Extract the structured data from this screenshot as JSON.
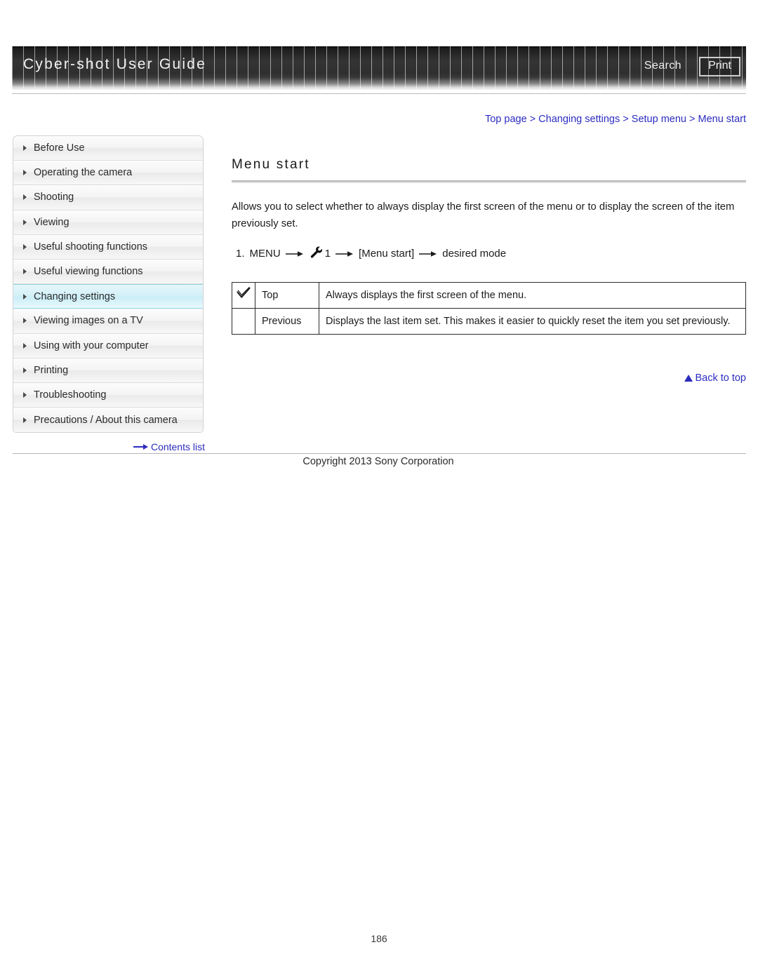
{
  "header": {
    "site_title": "Cyber-shot User Guide",
    "search_label": "Search",
    "print_label": "Print"
  },
  "breadcrumb": {
    "text": "Top page > Changing settings > Setup menu > Menu start"
  },
  "sidebar": {
    "items": [
      {
        "label": "Before Use",
        "active": false
      },
      {
        "label": "Operating the camera",
        "active": false
      },
      {
        "label": "Shooting",
        "active": false
      },
      {
        "label": "Viewing",
        "active": false
      },
      {
        "label": "Useful shooting functions",
        "active": false
      },
      {
        "label": "Useful viewing functions",
        "active": false
      },
      {
        "label": "Changing settings",
        "active": true
      },
      {
        "label": "Viewing images on a TV",
        "active": false
      },
      {
        "label": "Using with your computer",
        "active": false
      },
      {
        "label": "Printing",
        "active": false
      },
      {
        "label": "Troubleshooting",
        "active": false
      },
      {
        "label": "Precautions / About this camera",
        "active": false
      }
    ],
    "contents_list_label": "Contents list"
  },
  "main": {
    "title": "Menu start",
    "intro": "Allows you to select whether to always display the first screen of the menu or to display the screen of the item previously set.",
    "step": {
      "number": "1.",
      "part1": "MENU",
      "part2": "1",
      "part3": "[Menu start]",
      "part4": "desired mode"
    },
    "table": {
      "rows": [
        {
          "checked": true,
          "name": "Top",
          "description": "Always displays the first screen of the menu."
        },
        {
          "checked": false,
          "name": "Previous",
          "description": "Displays the last item set. This makes it easier to quickly reset the item you set previously."
        }
      ]
    },
    "back_to_top_label": "Back to top"
  },
  "footer": {
    "copyright": "Copyright 2013 Sony Corporation",
    "page_number": "186"
  },
  "colors": {
    "link": "#2c2cc0",
    "active_nav": "#c9edf7",
    "header_dark": "#1d1d1d"
  }
}
